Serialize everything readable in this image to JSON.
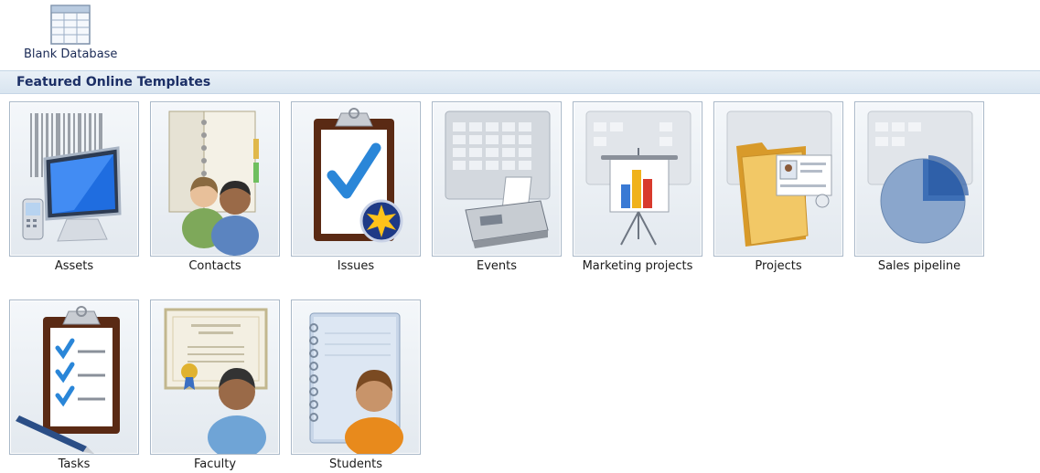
{
  "blank_database": {
    "label": "Blank Database",
    "icon": "table-grid-icon"
  },
  "featured": {
    "header": "Featured Online Templates",
    "templates": [
      {
        "label": "Assets",
        "icon": "computer-monitor-icon"
      },
      {
        "label": "Contacts",
        "icon": "people-icon"
      },
      {
        "label": "Issues",
        "icon": "clipboard-check-icon"
      },
      {
        "label": "Events",
        "icon": "fax-calendar-icon"
      },
      {
        "label": "Marketing projects",
        "icon": "presentation-chart-icon"
      },
      {
        "label": "Projects",
        "icon": "folder-icon"
      },
      {
        "label": "Sales pipeline",
        "icon": "pie-chart-icon"
      },
      {
        "label": "Tasks",
        "icon": "task-list-icon"
      },
      {
        "label": "Faculty",
        "icon": "certificate-person-icon"
      },
      {
        "label": "Students",
        "icon": "notebook-person-icon"
      }
    ]
  },
  "colors": {
    "header_bg": "#dde8f2",
    "header_text": "#1c2f66",
    "tile_border": "#a9b8c8"
  }
}
